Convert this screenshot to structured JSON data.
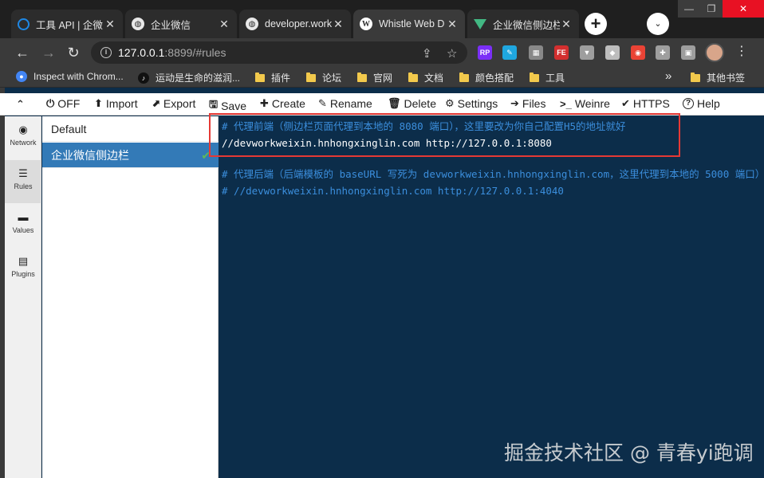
{
  "browser": {
    "tabs": [
      {
        "title": "工具 API | 企微",
        "icon": "qcloud-icon"
      },
      {
        "title": "企业微信",
        "icon": "globe-icon"
      },
      {
        "title": "developer.work",
        "icon": "globe-icon"
      },
      {
        "title": "Whistle Web D",
        "icon": "whistle-icon"
      },
      {
        "title": "企业微信侧边栏",
        "icon": "vue-icon"
      }
    ],
    "close_glyph": "✕",
    "new_tab_glyph": "+",
    "tab_menu_glyph": "⌄",
    "window_controls": [
      "—",
      "❐",
      "✕"
    ],
    "address": {
      "host": "127.0.0.1",
      "path": ":8899/#rules"
    },
    "bookmarks": [
      {
        "label": "Inspect with Chrom...",
        "type": "site"
      },
      {
        "label": "运动是生命的滋润...",
        "type": "tiktok"
      },
      {
        "label": "插件",
        "type": "folder"
      },
      {
        "label": "论坛",
        "type": "folder"
      },
      {
        "label": "官网",
        "type": "folder"
      },
      {
        "label": "文档",
        "type": "folder"
      },
      {
        "label": "颜色搭配",
        "type": "folder"
      },
      {
        "label": "工具",
        "type": "folder"
      }
    ],
    "bookmarks_overflow": "»",
    "other_bookmarks": "其他书签",
    "extensions": [
      {
        "label": "RP",
        "color": "#7b2ff7"
      },
      {
        "label": "✎",
        "color": "#1fa7e0"
      },
      {
        "label": "▦",
        "color": "#888888"
      },
      {
        "label": "FE",
        "color": "#d32f2f"
      },
      {
        "label": "▼",
        "color": "#9e9e9e"
      },
      {
        "label": "◆",
        "color": "#bdbdbd"
      },
      {
        "label": "◉",
        "color": "#ea4335"
      },
      {
        "label": "✚",
        "color": "#9e9e9e"
      },
      {
        "label": "▣",
        "color": "#9e9e9e"
      }
    ]
  },
  "menu": {
    "items": [
      {
        "icon": "⏻",
        "label": "OFF"
      },
      {
        "icon": "⬆",
        "label": "Import"
      },
      {
        "icon": "⬈",
        "label": "Export"
      },
      {
        "icon": "🖫",
        "label": "Save"
      },
      {
        "icon": "✚",
        "label": "Create"
      },
      {
        "icon": "✎",
        "label": "Rename"
      },
      {
        "icon": "🗑",
        "label": "Delete"
      },
      {
        "icon": "⚙",
        "label": "Settings"
      },
      {
        "icon": "➔",
        "label": "Files"
      },
      {
        "icon": ">_",
        "label": "Weinre"
      },
      {
        "icon": "✔",
        "label": "HTTPS"
      },
      {
        "icon": "?",
        "label": "Help"
      }
    ],
    "collapse_glyph": "⌃"
  },
  "leftnav": [
    {
      "label": "Network",
      "icon": "◉"
    },
    {
      "label": "Rules",
      "icon": "☰"
    },
    {
      "label": "Values",
      "icon": "▬"
    },
    {
      "label": "Plugins",
      "icon": "▤"
    }
  ],
  "rules": [
    {
      "name": "Default",
      "selected": false
    },
    {
      "name": "企业微信侧边栏",
      "selected": true,
      "check": "✔"
    }
  ],
  "editor": {
    "lines": [
      {
        "text": "# 代理前端（侧边栏页面代理到本地的 8080 端口），这里要改为你自己配置H5的地址就好",
        "kind": "comment"
      },
      {
        "text": "//devworkweixin.hnhongxinglin.com http://127.0.0.1:8080",
        "kind": "code"
      },
      {
        "text": "",
        "kind": "code"
      },
      {
        "text": "# 代理后端（后端模板的 baseURL 写死为 devworkweixin.hnhongxinglin.com，这里代理到本地的 5000 端口）",
        "kind": "comment"
      },
      {
        "text": "# //devworkweixin.hnhongxinglin.com http://127.0.0.1:4040",
        "kind": "comment"
      }
    ]
  },
  "watermark": "掘金技术社区 @ 青春yi跑调",
  "colors": {
    "accent": "#337ab7",
    "editor_bg": "#0c2d4a",
    "comment": "#3b8edc",
    "highlight": "#e53935"
  }
}
